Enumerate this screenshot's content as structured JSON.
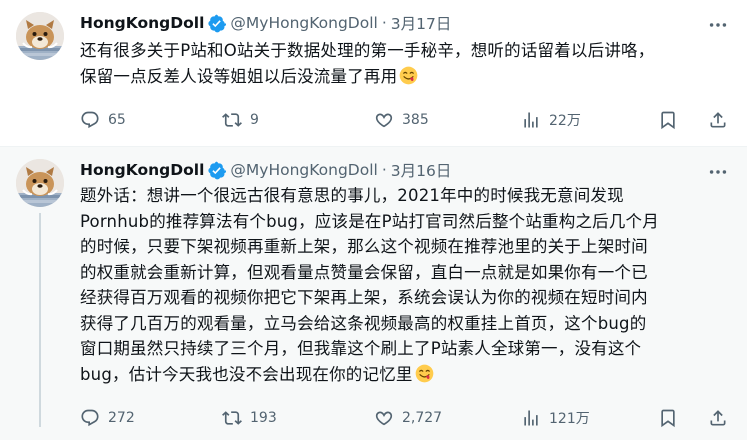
{
  "tweets": [
    {
      "author": {
        "name": "HongKongDoll",
        "handle": "@MyHongKongDoll",
        "verified": true
      },
      "separator": "·",
      "date": "3月17日",
      "text_lines": [
        "还有很多关于P站和O站关于数据处理的第一手秘辛，想听的话留着以后讲咯，",
        "保留一点反差人设等姐姐以后没流量了再用"
      ],
      "stats": {
        "replies": "65",
        "retweets": "9",
        "likes": "385",
        "views": "22万"
      }
    },
    {
      "author": {
        "name": "HongKongDoll",
        "handle": "@MyHongKongDoll",
        "verified": true
      },
      "separator": "·",
      "date": "3月16日",
      "text_lines": [
        "题外话：想讲一个很远古很有意思的事儿，2021年中的时候我无意间发现",
        "Pornhub的推荐算法有个bug，应该是在P站打官司然后整个站重构之后几个月",
        "的时候，只要下架视频再重新上架，那么这个视频在推荐池里的关于上架时间",
        "的权重就会重新计算，但观看量点赞量会保留，直白一点就是如果你有一个已",
        "经获得百万观看的视频你把它下架再上架，系统会误认为你的视频在短时间内",
        "获得了几百万的观看量，立马会给这条视频最高的权重挂上首页，这个bug的",
        "窗口期虽然只持续了三个月，但我靠这个刷上了P站素人全球第一，没有这个",
        "bug，估计今天我也没不会出现在你的记忆里"
      ],
      "stats": {
        "replies": "272",
        "retweets": "193",
        "likes": "2,727",
        "views": "121万"
      }
    }
  ],
  "icons": {
    "verified": "verified-badge-icon",
    "more": "more-dots-icon",
    "reply": "reply-bubble-icon",
    "retweet": "retweet-arrows-icon",
    "like": "heart-icon",
    "views": "views-bars-icon",
    "bookmark": "bookmark-icon",
    "share": "share-upload-icon",
    "emoji": "face-savoring-food-emoji"
  },
  "colors": {
    "accent": "#1d9bf0",
    "muted": "#536471",
    "text": "#0f1419",
    "thread_bg": "#f7f9f9"
  }
}
